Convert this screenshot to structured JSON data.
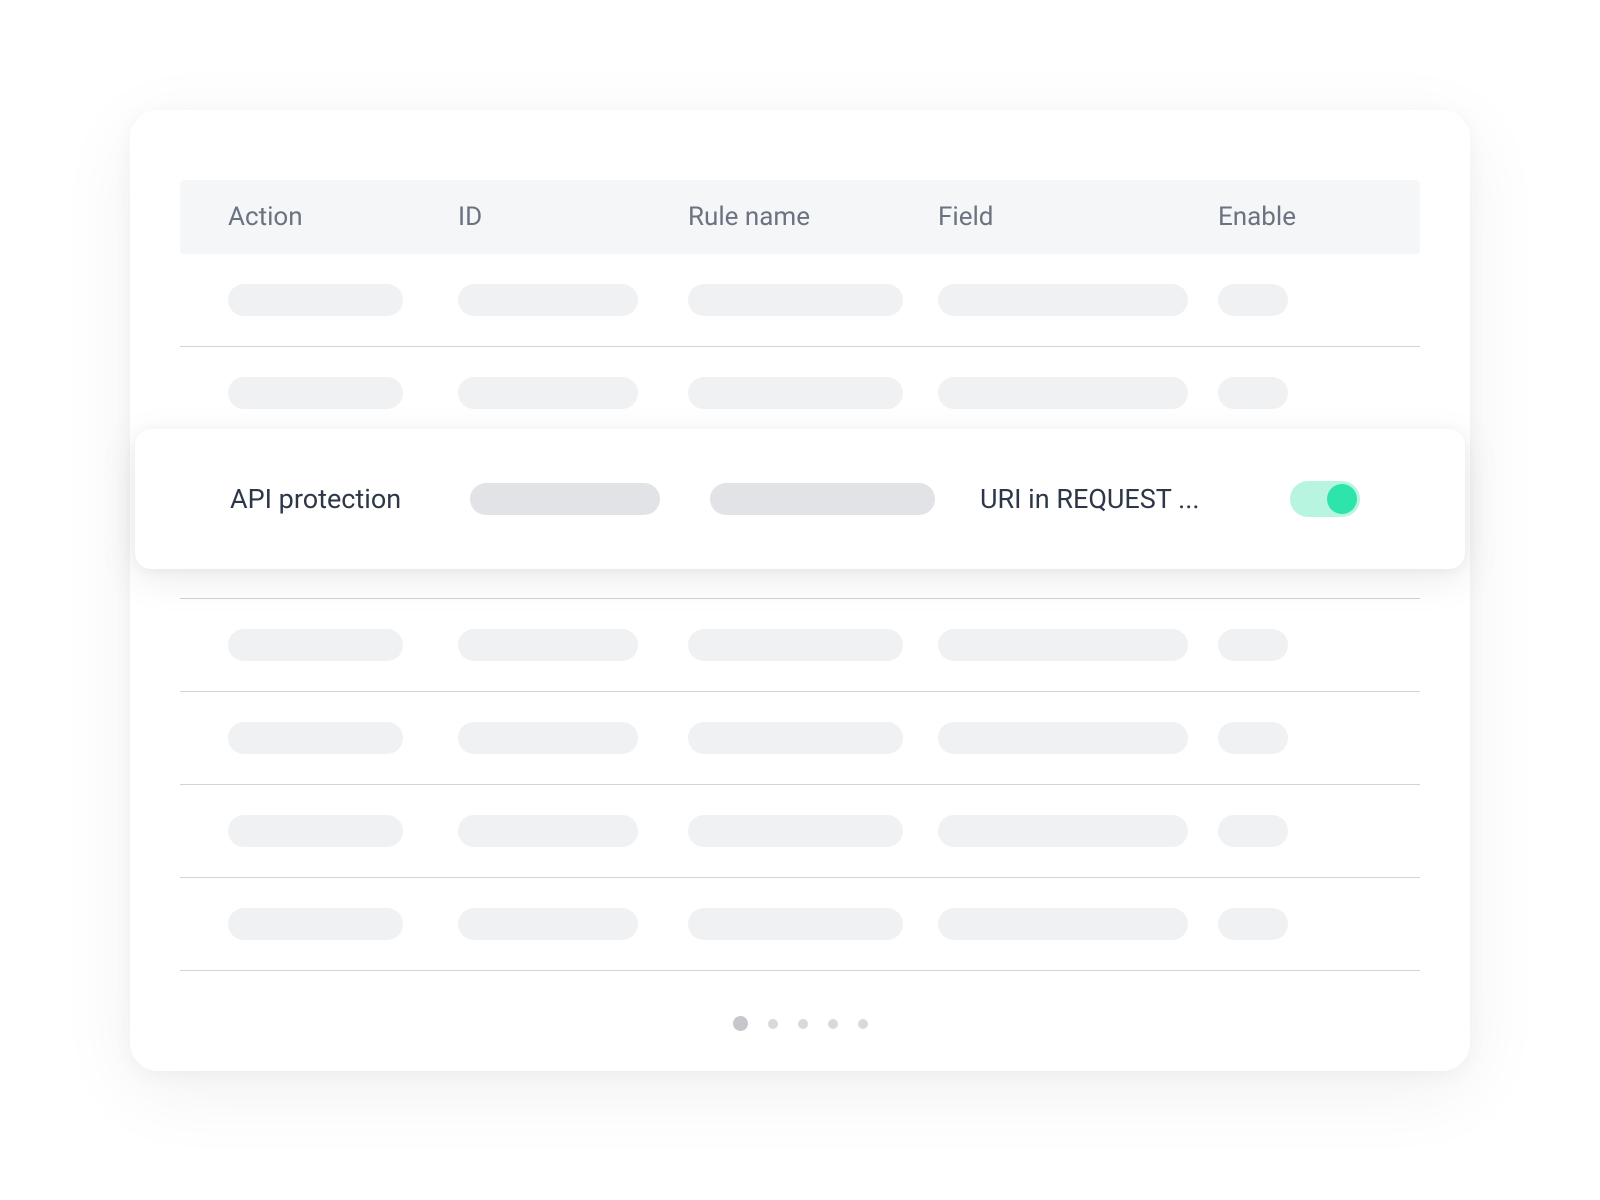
{
  "table": {
    "headers": {
      "action": "Action",
      "id": "ID",
      "rule_name": "Rule name",
      "field": "Field",
      "enable": "Enable"
    }
  },
  "highlighted_row": {
    "action": "API protection",
    "field": "URI in REQUEST ...",
    "enabled": true
  },
  "pagination": {
    "total_pages": 5,
    "current_page": 1
  },
  "colors": {
    "toggle_track": "#b8f5e0",
    "toggle_knob": "#2de5ab"
  }
}
